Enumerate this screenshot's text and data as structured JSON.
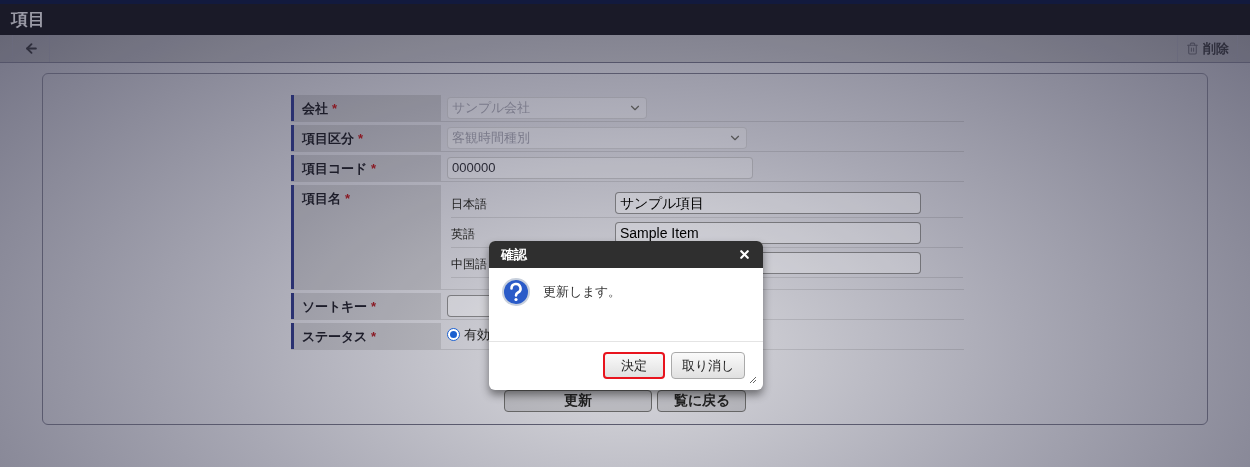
{
  "window": {
    "title": "項目"
  },
  "toolbar": {
    "delete_label": "削除"
  },
  "form": {
    "rows": [
      {
        "kind": "select",
        "label": "会社",
        "required_mark": "*",
        "value": "サンプル会社",
        "disabled": true
      },
      {
        "kind": "select",
        "label": "項目区分",
        "required_mark": "*",
        "value": "客観時間種別",
        "disabled": true
      },
      {
        "kind": "text",
        "label": "項目コード",
        "required_mark": "*",
        "value": "000000",
        "disabled": true
      },
      {
        "kind": "multilang",
        "label": "項目名",
        "required_mark": "*",
        "languages": [
          {
            "language": "日本語",
            "value": "サンプル項目"
          },
          {
            "language": "英語",
            "value": "Sample Item"
          },
          {
            "language": "中国語"
          }
        ]
      },
      {
        "kind": "text",
        "label": "ソートキー",
        "required_mark": "*",
        "disabled": false
      },
      {
        "kind": "radio",
        "label": "ステータス",
        "required_mark": "*",
        "options": [
          {
            "label": "有効",
            "selected": true
          }
        ]
      }
    ]
  },
  "actions": [
    "更新",
    "覧に戻る"
  ],
  "dialog": {
    "title": "確認",
    "message": "更新します。",
    "buttons": [
      {
        "label": "決定",
        "focused": true
      },
      {
        "label": "取り消し",
        "focused": false
      }
    ]
  }
}
